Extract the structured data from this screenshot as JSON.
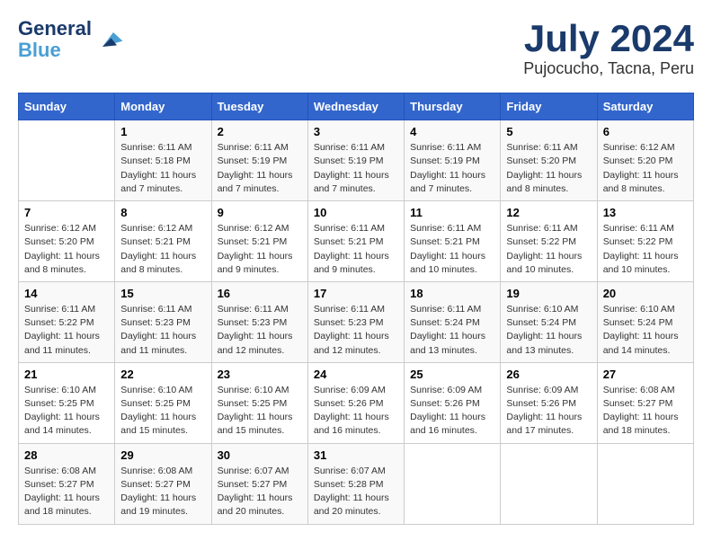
{
  "header": {
    "logo_line1": "General",
    "logo_line2": "Blue",
    "month": "July 2024",
    "location": "Pujocucho, Tacna, Peru"
  },
  "weekdays": [
    "Sunday",
    "Monday",
    "Tuesday",
    "Wednesday",
    "Thursday",
    "Friday",
    "Saturday"
  ],
  "weeks": [
    [
      {
        "day": "",
        "info": ""
      },
      {
        "day": "1",
        "info": "Sunrise: 6:11 AM\nSunset: 5:18 PM\nDaylight: 11 hours and 7 minutes."
      },
      {
        "day": "2",
        "info": "Sunrise: 6:11 AM\nSunset: 5:19 PM\nDaylight: 11 hours and 7 minutes."
      },
      {
        "day": "3",
        "info": "Sunrise: 6:11 AM\nSunset: 5:19 PM\nDaylight: 11 hours and 7 minutes."
      },
      {
        "day": "4",
        "info": "Sunrise: 6:11 AM\nSunset: 5:19 PM\nDaylight: 11 hours and 7 minutes."
      },
      {
        "day": "5",
        "info": "Sunrise: 6:11 AM\nSunset: 5:20 PM\nDaylight: 11 hours and 8 minutes."
      },
      {
        "day": "6",
        "info": "Sunrise: 6:12 AM\nSunset: 5:20 PM\nDaylight: 11 hours and 8 minutes."
      }
    ],
    [
      {
        "day": "7",
        "info": "Sunrise: 6:12 AM\nSunset: 5:20 PM\nDaylight: 11 hours and 8 minutes."
      },
      {
        "day": "8",
        "info": "Sunrise: 6:12 AM\nSunset: 5:21 PM\nDaylight: 11 hours and 8 minutes."
      },
      {
        "day": "9",
        "info": "Sunrise: 6:12 AM\nSunset: 5:21 PM\nDaylight: 11 hours and 9 minutes."
      },
      {
        "day": "10",
        "info": "Sunrise: 6:11 AM\nSunset: 5:21 PM\nDaylight: 11 hours and 9 minutes."
      },
      {
        "day": "11",
        "info": "Sunrise: 6:11 AM\nSunset: 5:21 PM\nDaylight: 11 hours and 10 minutes."
      },
      {
        "day": "12",
        "info": "Sunrise: 6:11 AM\nSunset: 5:22 PM\nDaylight: 11 hours and 10 minutes."
      },
      {
        "day": "13",
        "info": "Sunrise: 6:11 AM\nSunset: 5:22 PM\nDaylight: 11 hours and 10 minutes."
      }
    ],
    [
      {
        "day": "14",
        "info": "Sunrise: 6:11 AM\nSunset: 5:22 PM\nDaylight: 11 hours and 11 minutes."
      },
      {
        "day": "15",
        "info": "Sunrise: 6:11 AM\nSunset: 5:23 PM\nDaylight: 11 hours and 11 minutes."
      },
      {
        "day": "16",
        "info": "Sunrise: 6:11 AM\nSunset: 5:23 PM\nDaylight: 11 hours and 12 minutes."
      },
      {
        "day": "17",
        "info": "Sunrise: 6:11 AM\nSunset: 5:23 PM\nDaylight: 11 hours and 12 minutes."
      },
      {
        "day": "18",
        "info": "Sunrise: 6:11 AM\nSunset: 5:24 PM\nDaylight: 11 hours and 13 minutes."
      },
      {
        "day": "19",
        "info": "Sunrise: 6:10 AM\nSunset: 5:24 PM\nDaylight: 11 hours and 13 minutes."
      },
      {
        "day": "20",
        "info": "Sunrise: 6:10 AM\nSunset: 5:24 PM\nDaylight: 11 hours and 14 minutes."
      }
    ],
    [
      {
        "day": "21",
        "info": "Sunrise: 6:10 AM\nSunset: 5:25 PM\nDaylight: 11 hours and 14 minutes."
      },
      {
        "day": "22",
        "info": "Sunrise: 6:10 AM\nSunset: 5:25 PM\nDaylight: 11 hours and 15 minutes."
      },
      {
        "day": "23",
        "info": "Sunrise: 6:10 AM\nSunset: 5:25 PM\nDaylight: 11 hours and 15 minutes."
      },
      {
        "day": "24",
        "info": "Sunrise: 6:09 AM\nSunset: 5:26 PM\nDaylight: 11 hours and 16 minutes."
      },
      {
        "day": "25",
        "info": "Sunrise: 6:09 AM\nSunset: 5:26 PM\nDaylight: 11 hours and 16 minutes."
      },
      {
        "day": "26",
        "info": "Sunrise: 6:09 AM\nSunset: 5:26 PM\nDaylight: 11 hours and 17 minutes."
      },
      {
        "day": "27",
        "info": "Sunrise: 6:08 AM\nSunset: 5:27 PM\nDaylight: 11 hours and 18 minutes."
      }
    ],
    [
      {
        "day": "28",
        "info": "Sunrise: 6:08 AM\nSunset: 5:27 PM\nDaylight: 11 hours and 18 minutes."
      },
      {
        "day": "29",
        "info": "Sunrise: 6:08 AM\nSunset: 5:27 PM\nDaylight: 11 hours and 19 minutes."
      },
      {
        "day": "30",
        "info": "Sunrise: 6:07 AM\nSunset: 5:27 PM\nDaylight: 11 hours and 20 minutes."
      },
      {
        "day": "31",
        "info": "Sunrise: 6:07 AM\nSunset: 5:28 PM\nDaylight: 11 hours and 20 minutes."
      },
      {
        "day": "",
        "info": ""
      },
      {
        "day": "",
        "info": ""
      },
      {
        "day": "",
        "info": ""
      }
    ]
  ]
}
